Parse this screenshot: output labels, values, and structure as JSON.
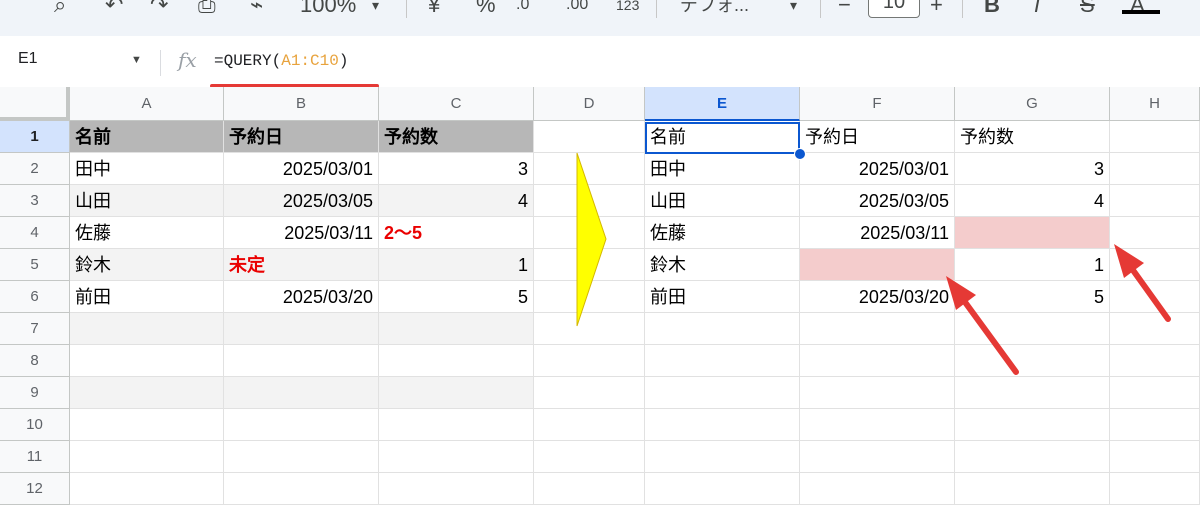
{
  "toolbar": {
    "zoom": "100%",
    "percent": "%",
    "dec_decrease": ".0",
    "dec_increase": ".00",
    "more_formats": "123",
    "font_name": "デフォ...",
    "font_size": "10",
    "minus": "−",
    "plus": "+",
    "bold": "B",
    "italic": "I",
    "strike": "S",
    "underline_text": "A"
  },
  "formula_bar": {
    "cell_ref": "E1",
    "fx": "fx",
    "formula_prefix": "=QUERY(",
    "formula_range": "A1:C10",
    "formula_suffix": ")"
  },
  "columns": [
    "A",
    "B",
    "C",
    "D",
    "E",
    "F",
    "G",
    "H"
  ],
  "rows": [
    "1",
    "2",
    "3",
    "4",
    "5",
    "6",
    "7",
    "8",
    "9",
    "10",
    "11",
    "12"
  ],
  "source_table": {
    "headers": [
      "名前",
      "予約日",
      "予約数"
    ],
    "rows": [
      [
        "田中",
        "2025/03/01",
        "3"
      ],
      [
        "山田",
        "2025/03/05",
        "4"
      ],
      [
        "佐藤",
        "2025/03/11",
        "2〜5"
      ],
      [
        "鈴木",
        "未定",
        "1"
      ],
      [
        "前田",
        "2025/03/20",
        "5"
      ]
    ]
  },
  "result_table": {
    "headers": [
      "名前",
      "予約日",
      "予約数"
    ],
    "rows": [
      [
        "田中",
        "2025/03/01",
        "3"
      ],
      [
        "山田",
        "2025/03/05",
        "4"
      ],
      [
        "佐藤",
        "2025/03/11",
        ""
      ],
      [
        "鈴木",
        "",
        "1"
      ],
      [
        "前田",
        "2025/03/20",
        "5"
      ]
    ]
  },
  "colors": {
    "header_fill": "#b7b7b7",
    "band_fill": "#f3f3f3",
    "error_text": "#ea0000",
    "empty_highlight": "#f4cccc",
    "selection": "#0b57d0",
    "arrow_fill": "#ffff00",
    "annotation_arrow": "#e53935",
    "formula_range": "#e8a33d"
  }
}
